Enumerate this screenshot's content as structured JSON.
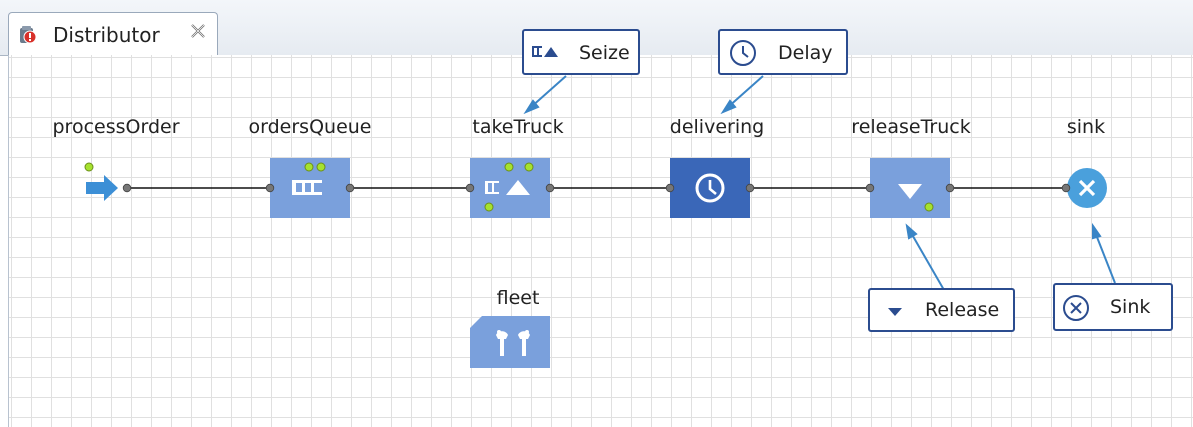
{
  "tab": {
    "title": "Distributor"
  },
  "blocks": {
    "processOrder": {
      "label": "processOrder"
    },
    "ordersQueue": {
      "label": "ordersQueue"
    },
    "takeTruck": {
      "label": "takeTruck"
    },
    "delivering": {
      "label": "delivering"
    },
    "releaseTruck": {
      "label": "releaseTruck"
    },
    "sink": {
      "label": "sink"
    },
    "fleet": {
      "label": "fleet"
    }
  },
  "callouts": {
    "seize": "Seize",
    "delay": "Delay",
    "release": "Release",
    "sink": "Sink"
  },
  "colors": {
    "block_light": "#7aa0dc",
    "block_dark": "#3a67b8",
    "source_arrow": "#3c8fd6",
    "sink_circle": "#4aa0dc",
    "port_green": "#a6e22e",
    "callout_border": "#2b4c8f",
    "callout_arrow": "#3a85c6"
  }
}
